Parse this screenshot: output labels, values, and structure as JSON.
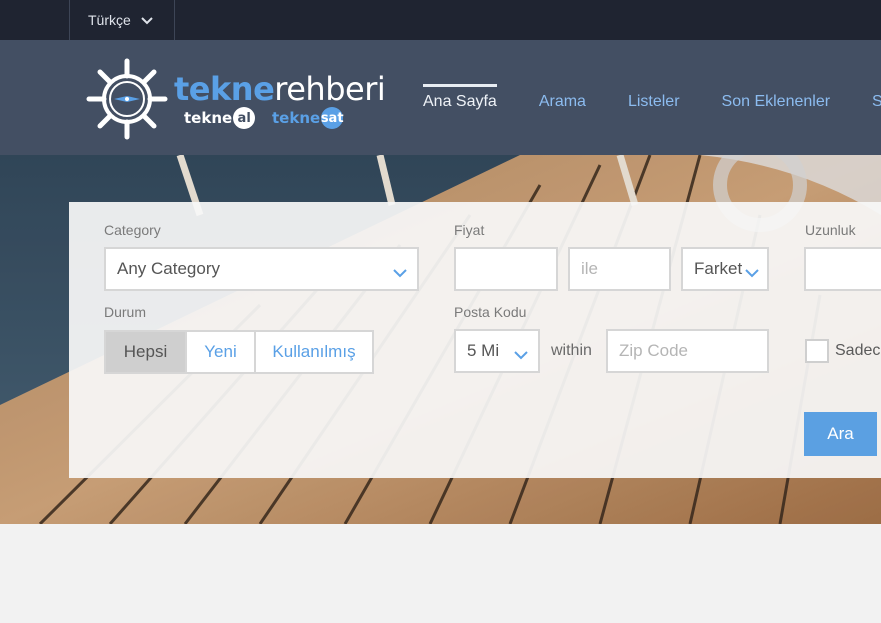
{
  "topbar": {
    "language": "Türkçe"
  },
  "logo": {
    "brand_part1": "tekne",
    "brand_part2": "rehberi",
    "sub1_text": "tekne",
    "sub1_pill": "al",
    "sub2_text": "tekne",
    "sub2_pill": "sat"
  },
  "nav": {
    "items": [
      {
        "label": "Ana Sayfa"
      },
      {
        "label": "Arama"
      },
      {
        "label": "Listeler"
      },
      {
        "label": "Son Eklenenler"
      },
      {
        "label": "Sa"
      }
    ],
    "active_index": 0
  },
  "search": {
    "category_label": "Category",
    "category_value": "Any Category",
    "price_label": "Fiyat",
    "price_min_value": "",
    "price_max_placeholder": "ile",
    "currency_value": "Farket",
    "length_label": "Uzunluk",
    "length_value": "",
    "condition_label": "Durum",
    "condition_options": [
      "Hepsi",
      "Yeni",
      "Kullanılmış"
    ],
    "postal_label": "Posta Kodu",
    "distance_value": "5 Mi",
    "within_text": "within",
    "zip_placeholder": "Zip Code",
    "checkbox_label": "Sadece",
    "submit_label": "Ara"
  },
  "colors": {
    "topbar_bg": "#1f2431",
    "header_bg": "#434f63",
    "accent": "#5aa0e6",
    "button": "#5ba0e2"
  }
}
